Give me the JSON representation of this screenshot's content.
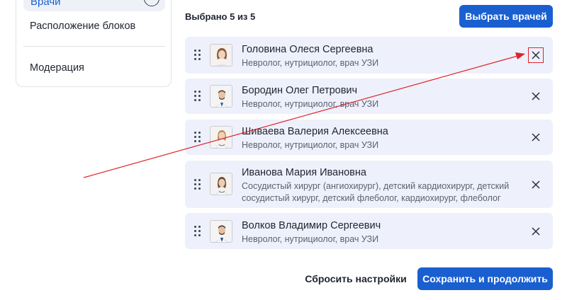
{
  "sidebar": {
    "active_item": "Врачи",
    "items": [
      "Расположение блоков",
      "Модерация"
    ]
  },
  "header": {
    "selected_count": "Выбрано 5 из 5",
    "choose_button": "Выбрать врачей"
  },
  "doctors": [
    {
      "name": "Головина Олеся Сергеевна",
      "specialty": "Невролог, нутрициолог, врач УЗИ"
    },
    {
      "name": "Бородин Олег Петрович",
      "specialty": "Невролог, нутрициолог, врач УЗИ"
    },
    {
      "name": "Шиваева Валерия Алексеевна",
      "specialty": "Невролог, нутрициолог, врач УЗИ"
    },
    {
      "name": "Иванова Мария Ивановна",
      "specialty": "Сосудистый хирург (ангиохирург), детский кардиохирург, детский сосудистый хирург, детский флеболог, кардиохирург, флеболог"
    },
    {
      "name": "Волков Владимир Сергеевич",
      "specialty": "Невролог, нутрициолог, врач УЗИ"
    }
  ],
  "footer": {
    "reset_button": "Сбросить настройки",
    "save_button": "Сохранить и продолжить"
  },
  "colors": {
    "primary": "#1a5fd0",
    "card_bg": "#eef1fb",
    "annotation": "#e0242c"
  },
  "icons": {
    "drag": "drag-handle-icon",
    "remove": "close-icon",
    "check": "check-circle-icon"
  }
}
